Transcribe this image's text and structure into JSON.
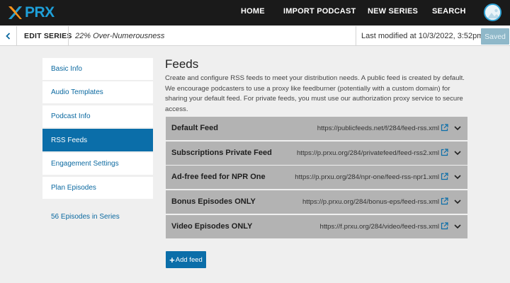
{
  "nav": {
    "logo_text": "PRX",
    "links": [
      "HOME",
      "IMPORT PODCAST",
      "NEW SERIES",
      "SEARCH"
    ]
  },
  "subbar": {
    "back_icon": "chevron-left-icon",
    "section": "EDIT SERIES",
    "series_title": "22% Over-Numerousness",
    "last_modified": "Last modified at 10/3/2022, 3:52pm",
    "saved_label": "Saved"
  },
  "sidebar": {
    "items": [
      {
        "label": "Basic Info",
        "active": false
      },
      {
        "label": "Audio Templates",
        "active": false
      },
      {
        "label": "Podcast Info",
        "active": false
      },
      {
        "label": "RSS Feeds",
        "active": true
      },
      {
        "label": "Engagement Settings",
        "active": false
      },
      {
        "label": "Plan Episodes",
        "active": false
      }
    ],
    "episodes_link": "56 Episodes in Series"
  },
  "main": {
    "title": "Feeds",
    "description": "Create and configure RSS feeds to meet your distribution needs. A public feed is created by default. We encourage podcasters to use a proxy like feedburner (potentially with a custom domain) for sharing your default feed. For private feeds, you must use our authorization proxy service to secure access.",
    "feeds": [
      {
        "name": "Default Feed",
        "url": "https://publicfeeds.net/f/284/feed-rss.xml"
      },
      {
        "name": "Subscriptions Private Feed",
        "url": "https://p.prxu.org/284/privatefeed/feed-rss2.xml"
      },
      {
        "name": "Ad-free feed for NPR One",
        "url": "https://p.prxu.org/284/npr-one/feed-rss-npr1.xml"
      },
      {
        "name": "Bonus Episodes ONLY",
        "url": "https://p.prxu.org/284/bonus-eps/feed-rss.xml"
      },
      {
        "name": "Video Episodes ONLY",
        "url": "https://f.prxu.org/284/video/feed-rss.xml"
      }
    ],
    "add_feed_label": "Add feed"
  },
  "colors": {
    "nav_bg": "#1a1a1a",
    "brand_blue": "#1e9fd8",
    "brand_orange": "#f7941d",
    "active_blue": "#0b6ea9",
    "link_blue": "#0b69a0",
    "feed_bg": "#b3b3b3",
    "saved_bg": "#8fb8c9"
  }
}
